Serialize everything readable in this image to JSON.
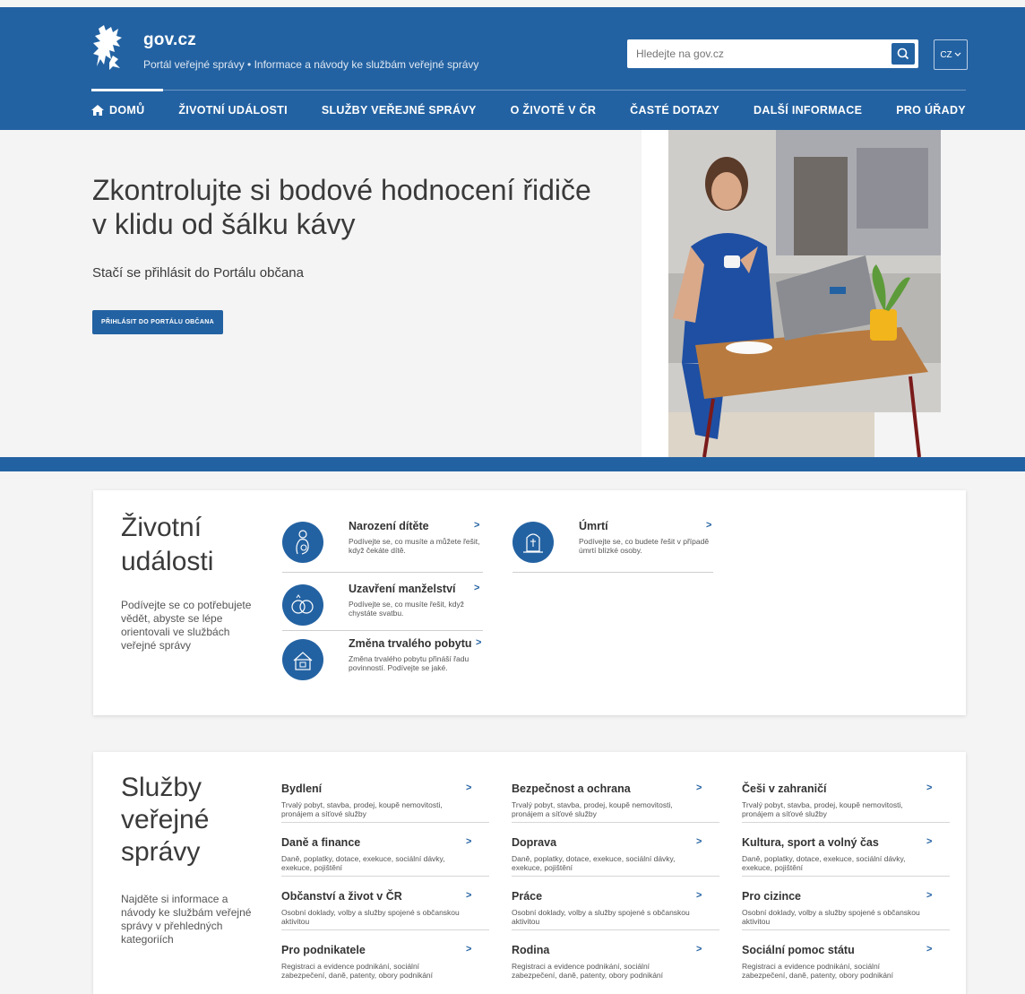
{
  "header": {
    "brand": "gov.cz",
    "tagline": "Portál veřejné správy • Informace a návody ke službám veřejné správy",
    "search_placeholder": "Hledejte na gov.cz",
    "lang": "CZ"
  },
  "nav": [
    {
      "label": "DOMŮ",
      "icon": "home-icon"
    },
    {
      "label": "ŽIVOTNÍ UDÁLOSTI"
    },
    {
      "label": "SLUŽBY VEŘEJNÉ SPRÁVY"
    },
    {
      "label": "O ŽIVOTĚ V ČR"
    },
    {
      "label": "ČASTÉ DOTAZY"
    },
    {
      "label": "DALŠÍ INFORMACE"
    },
    {
      "label": "PRO ÚŘADY"
    }
  ],
  "hero": {
    "title": "Zkontrolujte si bodové hodnocení řidiče v klidu od šálku kávy",
    "subtitle": "Stačí se přihlásit do Portálu občana",
    "button": "PŘIHLÁSIT DO PORTÁLU OBČANA"
  },
  "life_events": {
    "title_line1": "Životní",
    "title_line2": "události",
    "description": "Podívejte se co potřebujete vědět, abyste se lépe orientovali ve službách veřejné správy",
    "items": [
      {
        "title": "Narození dítěte",
        "text": "Podívejte se, co musíte a můžete řešit, když čekáte dítě.",
        "icon": "baby-icon"
      },
      {
        "title": "Uzavření manželství",
        "text": "Podívejte se, co musíte řešit, když chystáte svatbu.",
        "icon": "rings-icon"
      },
      {
        "title": "Změna trvalého pobytu",
        "text": "Změna trvalého pobytu přináší řadu povinností. Podívejte se jaké.",
        "icon": "house-icon"
      },
      {
        "title": "Úmrtí",
        "text": "Podívejte se, co budete řešit v případě úmrtí blízké osoby.",
        "icon": "grave-icon"
      }
    ]
  },
  "services": {
    "title_line1": "Služby",
    "title_line2": "veřejné",
    "title_line3": "správy",
    "description": "Najděte si informace a návody ke službám veřejné správy v přehledných kategoriích",
    "columns": [
      [
        {
          "title": "Bydlení",
          "text": "Trvalý pobyt, stavba, prodej, koupě nemovitosti, pronájem a síťové služby"
        },
        {
          "title": "Daně a finance",
          "text": "Daně, poplatky, dotace, exekuce, sociální dávky, exekuce, pojištění"
        },
        {
          "title": "Občanství a život v ČR",
          "text": "Osobní doklady, volby a služby spojené s občanskou aktivitou"
        },
        {
          "title": "Pro podnikatele",
          "text": "Registraci a evidence podnikání, sociální zabezpečení, daně, patenty, obory podnikání"
        }
      ],
      [
        {
          "title": "Bezpečnost a ochrana",
          "text": "Trvalý pobyt, stavba, prodej, koupě nemovitosti, pronájem a síťové služby"
        },
        {
          "title": "Doprava",
          "text": "Daně, poplatky, dotace, exekuce, sociální dávky, exekuce, pojištění"
        },
        {
          "title": "Práce",
          "text": "Osobní doklady, volby a služby spojené s občanskou aktivitou"
        },
        {
          "title": "Rodina",
          "text": "Registraci a evidence podnikání, sociální zabezpečení, daně, patenty, obory podnikání"
        }
      ],
      [
        {
          "title": "Češi v zahraničí",
          "text": "Trvalý pobyt, stavba, prodej, koupě nemovitosti, pronájem a síťové služby"
        },
        {
          "title": "Kultura, sport a volný čas",
          "text": "Daně, poplatky, dotace, exekuce, sociální dávky, exekuce, pojištění"
        },
        {
          "title": "Pro cizince",
          "text": "Osobní doklady, volby a služby spojené s občanskou aktivitou"
        },
        {
          "title": "Sociální pomoc státu",
          "text": "Registraci a evidence podnikání, sociální zabezpečení, daně, patenty, obory podnikání"
        }
      ]
    ]
  },
  "colors": {
    "primary": "#2362a2",
    "background": "#f4f4f4"
  }
}
